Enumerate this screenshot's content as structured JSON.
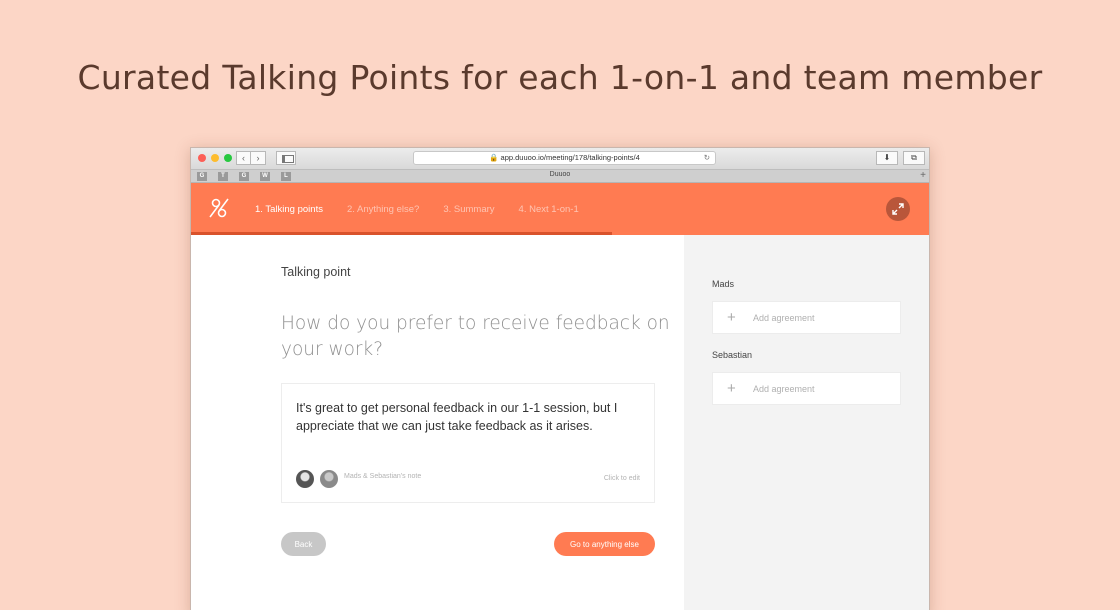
{
  "headline": "Curated Talking Points for each 1-on-1 and team member",
  "browser": {
    "url": "app.duuoo.io/meeting/178/talking-points/4",
    "tab_title": "Duuoo",
    "bookmarks": [
      "G",
      "T",
      "G",
      "W",
      "L"
    ]
  },
  "app": {
    "steps": [
      {
        "label": "1. Talking points",
        "active": true
      },
      {
        "label": "2. Anything else?",
        "active": false
      },
      {
        "label": "3. Summary",
        "active": false
      },
      {
        "label": "4. Next 1-on-1",
        "active": false
      }
    ],
    "progress": 0.57,
    "colors": {
      "accent": "#ff7b52",
      "background": "#fcd6c6"
    }
  },
  "talking_point": {
    "label": "Talking point",
    "question": "How do you prefer to receive feedback on your work?",
    "note_text": "It's great to get personal feedback in our 1-1 session, but I appreciate that we can just take feedback as it arises.",
    "note_author": "Mads & Sebastian's note",
    "click_to_edit": "Click to edit",
    "back_label": "Back",
    "next_label": "Go to anything else"
  },
  "agreements": [
    {
      "person": "Mads",
      "placeholder": "Add agreement"
    },
    {
      "person": "Sebastian",
      "placeholder": "Add agreement"
    }
  ]
}
